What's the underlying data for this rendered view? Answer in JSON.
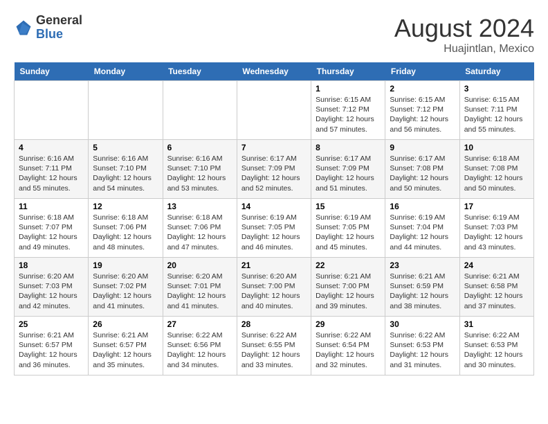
{
  "header": {
    "logo_general": "General",
    "logo_blue": "Blue",
    "month_year": "August 2024",
    "location": "Huajintlan, Mexico"
  },
  "weekdays": [
    "Sunday",
    "Monday",
    "Tuesday",
    "Wednesday",
    "Thursday",
    "Friday",
    "Saturday"
  ],
  "weeks": [
    [
      {
        "day": "",
        "info": ""
      },
      {
        "day": "",
        "info": ""
      },
      {
        "day": "",
        "info": ""
      },
      {
        "day": "",
        "info": ""
      },
      {
        "day": "1",
        "info": "Sunrise: 6:15 AM\nSunset: 7:12 PM\nDaylight: 12 hours\nand 57 minutes."
      },
      {
        "day": "2",
        "info": "Sunrise: 6:15 AM\nSunset: 7:12 PM\nDaylight: 12 hours\nand 56 minutes."
      },
      {
        "day": "3",
        "info": "Sunrise: 6:15 AM\nSunset: 7:11 PM\nDaylight: 12 hours\nand 55 minutes."
      }
    ],
    [
      {
        "day": "4",
        "info": "Sunrise: 6:16 AM\nSunset: 7:11 PM\nDaylight: 12 hours\nand 55 minutes."
      },
      {
        "day": "5",
        "info": "Sunrise: 6:16 AM\nSunset: 7:10 PM\nDaylight: 12 hours\nand 54 minutes."
      },
      {
        "day": "6",
        "info": "Sunrise: 6:16 AM\nSunset: 7:10 PM\nDaylight: 12 hours\nand 53 minutes."
      },
      {
        "day": "7",
        "info": "Sunrise: 6:17 AM\nSunset: 7:09 PM\nDaylight: 12 hours\nand 52 minutes."
      },
      {
        "day": "8",
        "info": "Sunrise: 6:17 AM\nSunset: 7:09 PM\nDaylight: 12 hours\nand 51 minutes."
      },
      {
        "day": "9",
        "info": "Sunrise: 6:17 AM\nSunset: 7:08 PM\nDaylight: 12 hours\nand 50 minutes."
      },
      {
        "day": "10",
        "info": "Sunrise: 6:18 AM\nSunset: 7:08 PM\nDaylight: 12 hours\nand 50 minutes."
      }
    ],
    [
      {
        "day": "11",
        "info": "Sunrise: 6:18 AM\nSunset: 7:07 PM\nDaylight: 12 hours\nand 49 minutes."
      },
      {
        "day": "12",
        "info": "Sunrise: 6:18 AM\nSunset: 7:06 PM\nDaylight: 12 hours\nand 48 minutes."
      },
      {
        "day": "13",
        "info": "Sunrise: 6:18 AM\nSunset: 7:06 PM\nDaylight: 12 hours\nand 47 minutes."
      },
      {
        "day": "14",
        "info": "Sunrise: 6:19 AM\nSunset: 7:05 PM\nDaylight: 12 hours\nand 46 minutes."
      },
      {
        "day": "15",
        "info": "Sunrise: 6:19 AM\nSunset: 7:05 PM\nDaylight: 12 hours\nand 45 minutes."
      },
      {
        "day": "16",
        "info": "Sunrise: 6:19 AM\nSunset: 7:04 PM\nDaylight: 12 hours\nand 44 minutes."
      },
      {
        "day": "17",
        "info": "Sunrise: 6:19 AM\nSunset: 7:03 PM\nDaylight: 12 hours\nand 43 minutes."
      }
    ],
    [
      {
        "day": "18",
        "info": "Sunrise: 6:20 AM\nSunset: 7:03 PM\nDaylight: 12 hours\nand 42 minutes."
      },
      {
        "day": "19",
        "info": "Sunrise: 6:20 AM\nSunset: 7:02 PM\nDaylight: 12 hours\nand 41 minutes."
      },
      {
        "day": "20",
        "info": "Sunrise: 6:20 AM\nSunset: 7:01 PM\nDaylight: 12 hours\nand 41 minutes."
      },
      {
        "day": "21",
        "info": "Sunrise: 6:20 AM\nSunset: 7:00 PM\nDaylight: 12 hours\nand 40 minutes."
      },
      {
        "day": "22",
        "info": "Sunrise: 6:21 AM\nSunset: 7:00 PM\nDaylight: 12 hours\nand 39 minutes."
      },
      {
        "day": "23",
        "info": "Sunrise: 6:21 AM\nSunset: 6:59 PM\nDaylight: 12 hours\nand 38 minutes."
      },
      {
        "day": "24",
        "info": "Sunrise: 6:21 AM\nSunset: 6:58 PM\nDaylight: 12 hours\nand 37 minutes."
      }
    ],
    [
      {
        "day": "25",
        "info": "Sunrise: 6:21 AM\nSunset: 6:57 PM\nDaylight: 12 hours\nand 36 minutes."
      },
      {
        "day": "26",
        "info": "Sunrise: 6:21 AM\nSunset: 6:57 PM\nDaylight: 12 hours\nand 35 minutes."
      },
      {
        "day": "27",
        "info": "Sunrise: 6:22 AM\nSunset: 6:56 PM\nDaylight: 12 hours\nand 34 minutes."
      },
      {
        "day": "28",
        "info": "Sunrise: 6:22 AM\nSunset: 6:55 PM\nDaylight: 12 hours\nand 33 minutes."
      },
      {
        "day": "29",
        "info": "Sunrise: 6:22 AM\nSunset: 6:54 PM\nDaylight: 12 hours\nand 32 minutes."
      },
      {
        "day": "30",
        "info": "Sunrise: 6:22 AM\nSunset: 6:53 PM\nDaylight: 12 hours\nand 31 minutes."
      },
      {
        "day": "31",
        "info": "Sunrise: 6:22 AM\nSunset: 6:53 PM\nDaylight: 12 hours\nand 30 minutes."
      }
    ]
  ]
}
